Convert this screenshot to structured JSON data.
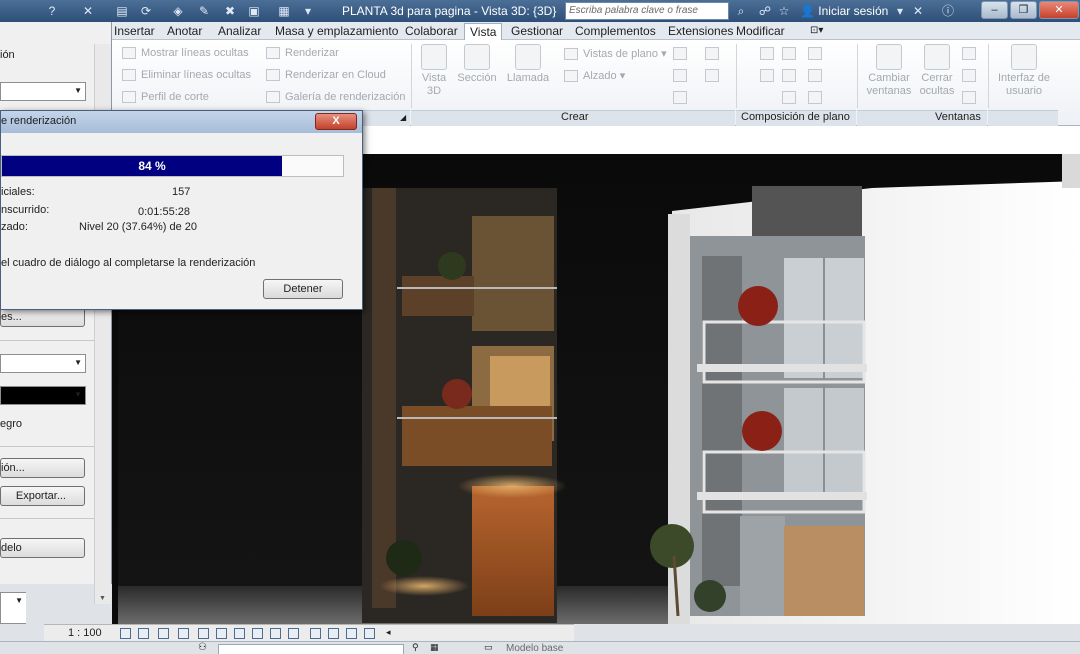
{
  "window": {
    "title": "PLANTA 3d para pagina - Vista 3D: {3D}",
    "search_placeholder": "Escriba palabra clave o frase",
    "signin_label": "Iniciar sesión",
    "help_label": "?",
    "minimize_label": "–",
    "restore_label": "❐",
    "close_label": "✕"
  },
  "tabs": [
    "Insertar",
    "Anotar",
    "Analizar",
    "Masa y emplazamiento",
    "Colaborar",
    "Vista",
    "Gestionar",
    "Complementos",
    "Extensiones",
    "Modificar"
  ],
  "active_tab": "Vista",
  "ribbon": {
    "graphics": {
      "items": [
        "Mostrar líneas ocultas",
        "Eliminar líneas ocultas",
        "Perfil de corte"
      ],
      "render_items": [
        "Renderizar",
        "Renderizar  en Cloud",
        "Galería de  renderización"
      ]
    },
    "create": {
      "label": "Crear",
      "vista3d": "Vista 3D",
      "seccion": "Sección",
      "llamada": "Llamada",
      "plan_views": "Vistas de plano",
      "elevation": "Alzado"
    },
    "sheet": {
      "label": "Composición de plano"
    },
    "windows": {
      "label": "Ventanas",
      "switch": "Cambiar ventanas",
      "close_hidden": "Cerrar ocultas",
      "ui": "Interfaz de usuario"
    }
  },
  "left_panel": {
    "top_text": "ión",
    "btn_settings": "es...",
    "bg_label": "egro",
    "btn_ajust": "ión...",
    "btn_export": "Exportar...",
    "btn_model": "delo"
  },
  "dialog": {
    "title": "e renderización",
    "close_label": "X",
    "progress_percent": 84,
    "progress_text": "84 %",
    "row1_label": "iciales:",
    "row1_value": "157",
    "row2_label": "nscurrido:",
    "row2_value": "0:01:55:28",
    "row3_label": "zado:",
    "row3_value": "Nivel 20 (37.64%) de 20",
    "close_on_finish": "el cuadro de diálogo al completarse la renderización",
    "stop_label": "Detener"
  },
  "viewbar": {
    "scale": "1 : 100"
  },
  "statusbar": {
    "model_label": "Modelo base"
  }
}
